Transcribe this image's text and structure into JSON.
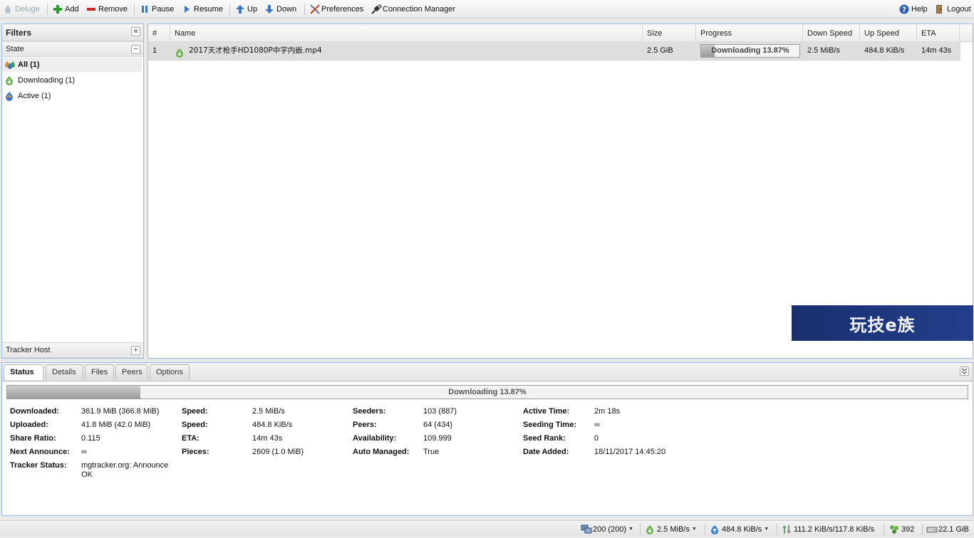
{
  "toolbar": {
    "app_label": "Deluge",
    "add": "Add",
    "remove": "Remove",
    "pause": "Pause",
    "resume": "Resume",
    "up": "Up",
    "down": "Down",
    "preferences": "Preferences",
    "connection_manager": "Connection Manager",
    "help": "Help",
    "logout": "Logout"
  },
  "filters": {
    "title": "Filters",
    "state_label": "State",
    "items": [
      {
        "label": "All (1)",
        "icon": "all-states-icon",
        "selected": true
      },
      {
        "label": "Downloading (1)",
        "icon": "downloading-icon",
        "selected": false
      },
      {
        "label": "Active (1)",
        "icon": "active-icon",
        "selected": false
      }
    ],
    "tracker_host_label": "Tracker Host"
  },
  "torrent_grid": {
    "columns": [
      "#",
      "Name",
      "Size",
      "Progress",
      "Down Speed",
      "Up Speed",
      "ETA"
    ],
    "rows": [
      {
        "num": "1",
        "name": "2017天才枪手HD1080P中字内嵌.mp4",
        "size": "2.5 GiB",
        "progress_text": "Downloading 13.87%",
        "progress_fraction": 0.1387,
        "down_speed": "2.5 MiB/s",
        "up_speed": "484.8 KiB/s",
        "eta": "14m 43s"
      }
    ]
  },
  "watermark": {
    "text": "玩技e族"
  },
  "details": {
    "tabs": [
      "Status",
      "Details",
      "Files",
      "Peers",
      "Options"
    ],
    "active_tab": "Status",
    "progress_text": "Downloading 13.87%",
    "progress_fraction": 0.1387,
    "fields": {
      "downloaded": {
        "label": "Downloaded:",
        "value": "361.9 MiB (366.8 MiB)"
      },
      "uploaded": {
        "label": "Uploaded:",
        "value": "41.8 MiB (42.0 MiB)"
      },
      "share_ratio": {
        "label": "Share Ratio:",
        "value": "0.115"
      },
      "next_announce": {
        "label": "Next Announce:",
        "value": "∞"
      },
      "tracker_status": {
        "label": "Tracker Status:",
        "value_line1": "mgtracker.org: Announce",
        "value_line2": "OK"
      },
      "down_speed": {
        "label": "Speed:",
        "value": "2.5 MiB/s"
      },
      "up_speed": {
        "label": "Speed:",
        "value": "484.8 KiB/s"
      },
      "eta": {
        "label": "ETA:",
        "value": "14m 43s"
      },
      "pieces": {
        "label": "Pieces:",
        "value": "2609 (1.0 MiB)"
      },
      "seeders": {
        "label": "Seeders:",
        "value": "103 (887)"
      },
      "peers": {
        "label": "Peers:",
        "value": "64 (434)"
      },
      "availability": {
        "label": "Availability:",
        "value": "109.999"
      },
      "auto_managed": {
        "label": "Auto Managed:",
        "value": "True"
      },
      "active_time": {
        "label": "Active Time:",
        "value": "2m 18s"
      },
      "seeding_time": {
        "label": "Seeding Time:",
        "value": "∞"
      },
      "seed_rank": {
        "label": "Seed Rank:",
        "value": "0"
      },
      "date_added": {
        "label": "Date Added:",
        "value": "18/11/2017 14:45:20"
      }
    }
  },
  "statusbar": {
    "connections": "200 (200)",
    "down_speed": "2.5 MiB/s",
    "up_speed": "484.8 KiB/s",
    "protocol_traffic": "111.2 KiB/s/117.8 KiB/s",
    "dht_nodes": "392",
    "free_space": "22.1 GiB"
  },
  "colors": {
    "panel_border": "#99bbe8",
    "progress_fill": "#9a9a9a",
    "selected_row": "#dedede",
    "watermark_bg": "#1c3577"
  }
}
